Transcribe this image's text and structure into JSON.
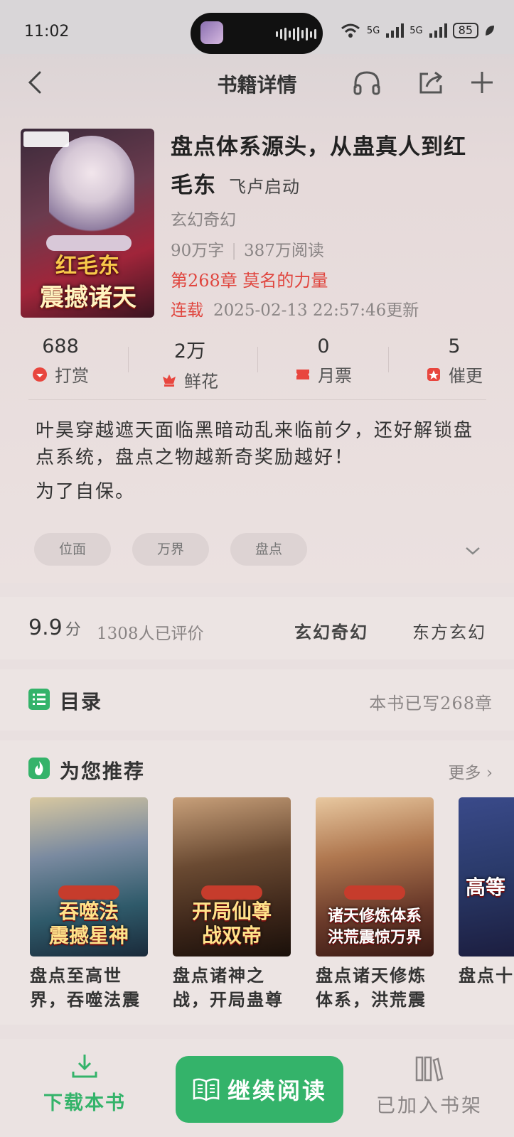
{
  "status_bar": {
    "time": "11:02",
    "battery": "85",
    "signal_1": "5G",
    "signal_2": "5G"
  },
  "nav": {
    "title": "书籍详情"
  },
  "book": {
    "title": "盘点体系源头，从蛊真人到红毛东",
    "author": "飞卢启动",
    "genre": "玄幻奇幻",
    "words": "90万字",
    "reads": "387万阅读",
    "latest_chapter": "第268章 莫名的力量",
    "status": "连载",
    "updated": "2025-02-13 22:57:46更新",
    "cover_title_1": "红毛东",
    "cover_title_2": "震撼诸天"
  },
  "stats": [
    {
      "value": "688",
      "label": "打赏",
      "icon": "reward-icon"
    },
    {
      "value": "2万",
      "label": "鲜花",
      "icon": "flower-icon"
    },
    {
      "value": "0",
      "label": "月票",
      "icon": "ticket-icon"
    },
    {
      "value": "5",
      "label": "催更",
      "icon": "urge-icon"
    }
  ],
  "intro": {
    "line1": "叶昊穿越遮天面临黑暗动乱来临前夕，还好解锁盘点系统，盘点之物越新奇奖励越好！",
    "line2": "为了自保。"
  },
  "tags": [
    "位面",
    "万界",
    "盘点"
  ],
  "rating": {
    "score": "9.9",
    "unit": "分",
    "reviews": "1308人已评价",
    "category_1": "玄幻奇幻",
    "category_2": "东方玄幻"
  },
  "toc": {
    "title": "目录",
    "count": "本书已写268章"
  },
  "recommend": {
    "title": "为您推荐",
    "more": "更多",
    "items": [
      {
        "name": "盘点至高世界，吞噬法震",
        "cover_text": "吞噬法\n震撼星神",
        "color_a": "#c8b48a",
        "color_b": "#2f5a6a"
      },
      {
        "name": "盘点诸神之战，开局蛊尊",
        "cover_text": "开局仙尊\n战双帝",
        "color_a": "#8a6a4a",
        "color_b": "#2a1a14"
      },
      {
        "name": "盘点诸天修炼体系，洪荒震",
        "cover_text": "诸天修炼体系\n洪荒震惊万界",
        "color_a": "#d8b088",
        "color_b": "#5a2a22"
      },
      {
        "name": "盘点十洪荒，",
        "cover_text": "高等",
        "color_a": "#3a4a8a",
        "color_b": "#1a1a3a"
      }
    ]
  },
  "bottom": {
    "download": "下载本书",
    "read": "继续阅读",
    "shelf": "已加入书架"
  },
  "colors": {
    "accent": "#34b36a",
    "highlight": "#e0463f"
  }
}
